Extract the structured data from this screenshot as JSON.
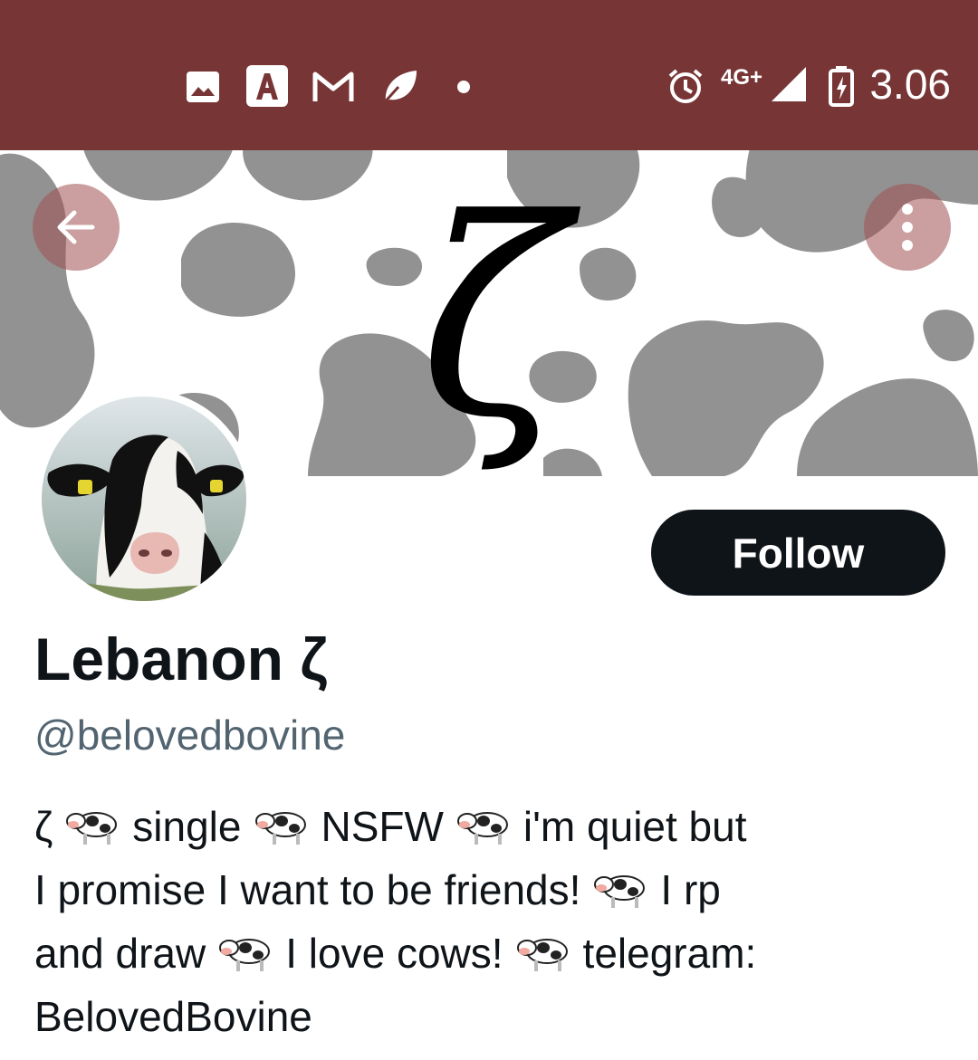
{
  "status_bar": {
    "network": "4G+",
    "time": "3.06",
    "icons": [
      "gallery-icon",
      "app-a-icon",
      "gmail-icon",
      "leaf-icon",
      "dot-icon",
      "alarm-icon",
      "signal-icon",
      "battery-icon"
    ]
  },
  "header": {
    "back_icon": "arrow-left-icon",
    "more_icon": "more-vertical-icon",
    "banner_glyph": "ζ"
  },
  "profile": {
    "display_name": "Lebanon ζ",
    "handle": "@belovedbovine",
    "follow_label": "Follow",
    "bio_lines": [
      [
        "ζ",
        "single",
        "NSFW",
        "i'm quiet but"
      ],
      [
        "I promise I want to be friends!",
        "I rp"
      ],
      [
        "and draw",
        "I love cows!",
        "telegram:"
      ],
      [
        "BelovedBovine"
      ]
    ]
  },
  "colors": {
    "status_bar": "#773535",
    "cow_spots": "#929292",
    "follow_button": "#0f1419",
    "handle_text": "#536471"
  }
}
